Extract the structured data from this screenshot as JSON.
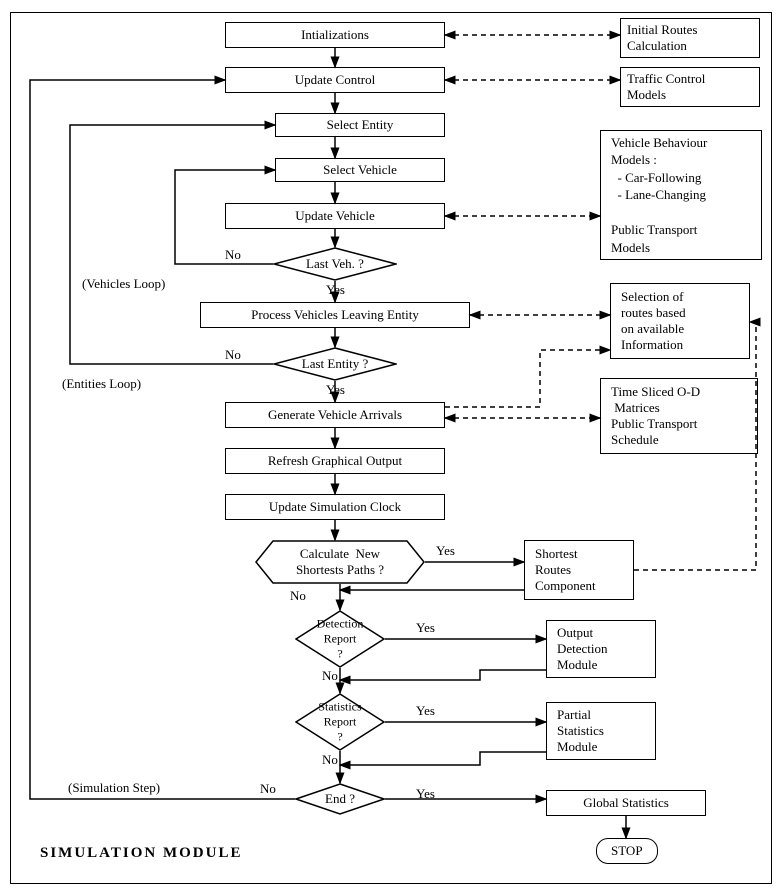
{
  "title": "SIMULATION MODULE",
  "steps": {
    "init": "Intializations",
    "update_control": "Update Control",
    "select_entity": "Select Entity",
    "select_vehicle": "Select Vehicle",
    "update_vehicle": "Update Vehicle",
    "process_leaving": "Process Vehicles Leaving Entity",
    "generate_arrivals": "Generate Vehicle Arrivals",
    "refresh_graphical": "Refresh Graphical Output",
    "update_clock": "Update Simulation Clock"
  },
  "decisions": {
    "last_veh": "Last Veh. ?",
    "last_entity": "Last Entity ?",
    "calc_paths": "Calculate  New\nShortests Paths ?",
    "detection_report": "Detection\nReport\n?",
    "statistics_report": "Statistics\nReport\n?",
    "end": "End ?"
  },
  "side": {
    "initial_routes": "Initial Routes\nCalculation",
    "traffic_control": "Traffic Control\nModels",
    "vehicle_behaviour": "Vehicle Behaviour\nModels :\n  - Car-Following\n  - Lane-Changing\n\nPublic Transport\nModels",
    "route_selection": "Selection of\nroutes based\non available\nInformation",
    "od_matrices": "Time Sliced O-D\n Matrices\nPublic Transport\nSchedule",
    "shortest_routes": "Shortest\nRoutes\nComponent",
    "output_detection": "Output\nDetection\nModule",
    "partial_stats": "Partial\nStatistics\nModule",
    "global_stats": "Global Statistics",
    "stop": "STOP"
  },
  "labels": {
    "yes": "Yes",
    "no": "No",
    "vehicles_loop": "(Vehicles Loop)",
    "entities_loop": "(Entities Loop)",
    "simulation_step": "(Simulation Step)"
  },
  "chart_data": {
    "type": "flowchart",
    "title": "SIMULATION MODULE",
    "nodes": [
      {
        "id": "init",
        "type": "process",
        "label": "Intializations"
      },
      {
        "id": "update_control",
        "type": "process",
        "label": "Update Control"
      },
      {
        "id": "select_entity",
        "type": "process",
        "label": "Select Entity"
      },
      {
        "id": "select_vehicle",
        "type": "process",
        "label": "Select Vehicle"
      },
      {
        "id": "update_vehicle",
        "type": "process",
        "label": "Update Vehicle"
      },
      {
        "id": "last_veh",
        "type": "decision",
        "label": "Last Veh. ?"
      },
      {
        "id": "process_leaving",
        "type": "process",
        "label": "Process Vehicles Leaving Entity"
      },
      {
        "id": "last_entity",
        "type": "decision",
        "label": "Last Entity ?"
      },
      {
        "id": "generate_arrivals",
        "type": "process",
        "label": "Generate Vehicle Arrivals"
      },
      {
        "id": "refresh_graphical",
        "type": "process",
        "label": "Refresh Graphical Output"
      },
      {
        "id": "update_clock",
        "type": "process",
        "label": "Update Simulation Clock"
      },
      {
        "id": "calc_paths",
        "type": "decision",
        "label": "Calculate New Shortests Paths ?"
      },
      {
        "id": "detection_report",
        "type": "decision",
        "label": "Detection Report ?"
      },
      {
        "id": "statistics_report",
        "type": "decision",
        "label": "Statistics Report ?"
      },
      {
        "id": "end",
        "type": "decision",
        "label": "End ?"
      },
      {
        "id": "initial_routes",
        "type": "external",
        "label": "Initial Routes Calculation"
      },
      {
        "id": "traffic_control",
        "type": "external",
        "label": "Traffic Control Models"
      },
      {
        "id": "vehicle_behaviour",
        "type": "external",
        "label": "Vehicle Behaviour Models : Car-Following, Lane-Changing; Public Transport Models"
      },
      {
        "id": "route_selection",
        "type": "external",
        "label": "Selection of routes based on available Information"
      },
      {
        "id": "od_matrices",
        "type": "external",
        "label": "Time Sliced O-D Matrices; Public Transport Schedule"
      },
      {
        "id": "shortest_routes",
        "type": "external",
        "label": "Shortest Routes Component"
      },
      {
        "id": "output_detection",
        "type": "external",
        "label": "Output Detection Module"
      },
      {
        "id": "partial_stats",
        "type": "external",
        "label": "Partial Statistics Module"
      },
      {
        "id": "global_stats",
        "type": "external",
        "label": "Global Statistics"
      },
      {
        "id": "stop",
        "type": "terminator",
        "label": "STOP"
      }
    ],
    "edges": [
      {
        "from": "init",
        "to": "update_control"
      },
      {
        "from": "update_control",
        "to": "select_entity"
      },
      {
        "from": "select_entity",
        "to": "select_vehicle"
      },
      {
        "from": "select_vehicle",
        "to": "update_vehicle"
      },
      {
        "from": "update_vehicle",
        "to": "last_veh"
      },
      {
        "from": "last_veh",
        "to": "select_vehicle",
        "label": "No",
        "loop": "Vehicles Loop"
      },
      {
        "from": "last_veh",
        "to": "process_leaving",
        "label": "Yes"
      },
      {
        "from": "process_leaving",
        "to": "last_entity"
      },
      {
        "from": "last_entity",
        "to": "select_entity",
        "label": "No",
        "loop": "Entities Loop"
      },
      {
        "from": "last_entity",
        "to": "generate_arrivals",
        "label": "Yes"
      },
      {
        "from": "generate_arrivals",
        "to": "refresh_graphical"
      },
      {
        "from": "refresh_graphical",
        "to": "update_clock"
      },
      {
        "from": "update_clock",
        "to": "calc_paths"
      },
      {
        "from": "calc_paths",
        "to": "shortest_routes",
        "label": "Yes"
      },
      {
        "from": "calc_paths",
        "to": "detection_report",
        "label": "No"
      },
      {
        "from": "detection_report",
        "to": "output_detection",
        "label": "Yes"
      },
      {
        "from": "detection_report",
        "to": "statistics_report",
        "label": "No"
      },
      {
        "from": "statistics_report",
        "to": "partial_stats",
        "label": "Yes"
      },
      {
        "from": "statistics_report",
        "to": "end",
        "label": "No"
      },
      {
        "from": "end",
        "to": "update_control",
        "label": "No",
        "loop": "Simulation Step"
      },
      {
        "from": "end",
        "to": "global_stats",
        "label": "Yes"
      },
      {
        "from": "global_stats",
        "to": "stop"
      },
      {
        "from": "init",
        "to": "initial_routes",
        "style": "dashed-bidir"
      },
      {
        "from": "update_control",
        "to": "traffic_control",
        "style": "dashed-bidir"
      },
      {
        "from": "update_vehicle",
        "to": "vehicle_behaviour",
        "style": "dashed-bidir"
      },
      {
        "from": "process_leaving",
        "to": "route_selection",
        "style": "dashed-bidir"
      },
      {
        "from": "generate_arrivals",
        "to": "route_selection",
        "style": "dashed"
      },
      {
        "from": "generate_arrivals",
        "to": "od_matrices",
        "style": "dashed-bidir"
      },
      {
        "from": "shortest_routes",
        "to": "route_selection",
        "style": "dashed"
      }
    ]
  }
}
